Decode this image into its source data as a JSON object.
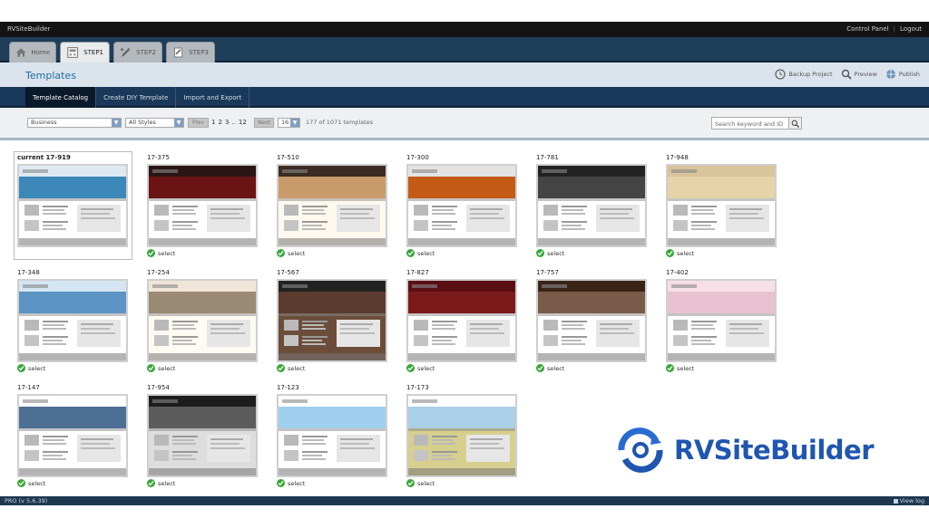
{
  "titlebar": {
    "app_name": "RVSiteBuilder",
    "control_panel": "Control Panel",
    "logout": "Logout"
  },
  "steps": [
    {
      "label": "Home",
      "icon": "home-icon"
    },
    {
      "label": "STEP1",
      "icon": "template-icon"
    },
    {
      "label": "STEP2",
      "icon": "edit-icon"
    },
    {
      "label": "STEP3",
      "icon": "publish-icon"
    }
  ],
  "page": {
    "title": "Templates"
  },
  "actions": {
    "backup": "Backup Project",
    "preview": "Preview",
    "publish": "Publish"
  },
  "subtabs": [
    "Template Catalog",
    "Create DIY Template",
    "Import and Export"
  ],
  "filters": {
    "category": "Business",
    "style": "All Styles",
    "prev": "Prev",
    "pages": [
      "1",
      "2",
      "3",
      "..",
      "12"
    ],
    "next": "Next",
    "per_page": "16",
    "count_text": "177 of 1071 templates",
    "search_placeholder": "Search keyword and ID"
  },
  "select_label": "select",
  "templates": [
    {
      "id": "current 17-919",
      "header": "#dfe9f2",
      "hero": "#3c88b8",
      "body": "#ffffff"
    },
    {
      "id": "17-375",
      "header": "#2a1414",
      "hero": "#6b1414",
      "body": "#ffffff"
    },
    {
      "id": "17-510",
      "header": "#3b2b22",
      "hero": "#c99a6a",
      "body": "#fff8ee"
    },
    {
      "id": "17-300",
      "header": "#e3e3e3",
      "hero": "#c55a14",
      "body": "#ffffff"
    },
    {
      "id": "17-781",
      "header": "#222222",
      "hero": "#444444",
      "body": "#ffffff"
    },
    {
      "id": "17-948",
      "header": "#d9c49c",
      "hero": "#e6d4a8",
      "body": "#ffffff"
    },
    {
      "id": "17-348",
      "header": "#d5e6f2",
      "hero": "#5a93c4",
      "body": "#ffffff"
    },
    {
      "id": "17-254",
      "header": "#efe6d8",
      "hero": "#9a8a74",
      "body": "#fffaf2"
    },
    {
      "id": "17-567",
      "header": "#222222",
      "hero": "#5a3b2e",
      "body": "#6b4d3a"
    },
    {
      "id": "17-827",
      "header": "#5a0f14",
      "hero": "#7a1a1a",
      "body": "#ffffff"
    },
    {
      "id": "17-757",
      "header": "#3a2418",
      "hero": "#7a5a48",
      "body": "#ffffff"
    },
    {
      "id": "17-402",
      "header": "#f6dfe6",
      "hero": "#e8c2d0",
      "body": "#ffffff"
    },
    {
      "id": "17-147",
      "header": "#ffffff",
      "hero": "#4d6f94",
      "body": "#ffffff"
    },
    {
      "id": "17-954",
      "header": "#1d1d1d",
      "hero": "#5c5c5c",
      "body": "#dddddd"
    },
    {
      "id": "17-123",
      "header": "#ffffff",
      "hero": "#9fd0ef",
      "body": "#ffffff"
    },
    {
      "id": "17-173",
      "header": "#ffffff",
      "hero": "#a9d0e6",
      "body": "#d6cf8e"
    }
  ],
  "brand": {
    "name": "RVSiteBuilder",
    "color": "#1f56b0"
  },
  "footer": {
    "version": "PRO (v 5.6.39)",
    "view_log": "View log"
  },
  "colors": {
    "navbar": "#1e3e5a",
    "accent": "#1b6da3",
    "select_green": "#3aa73a"
  }
}
